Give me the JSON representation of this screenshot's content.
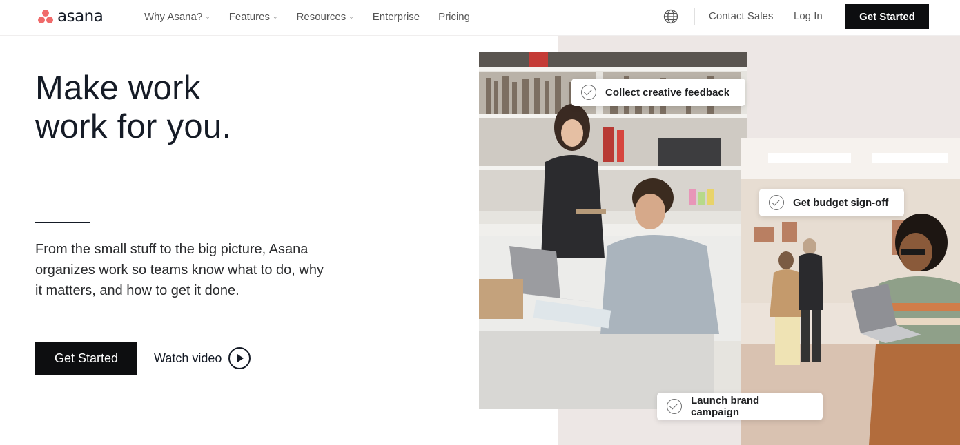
{
  "brand": {
    "name": "asana",
    "color": "#f06a6a"
  },
  "nav": {
    "items": [
      {
        "label": "Why Asana?",
        "dropdown": true
      },
      {
        "label": "Features",
        "dropdown": true
      },
      {
        "label": "Resources",
        "dropdown": true
      },
      {
        "label": "Enterprise",
        "dropdown": false
      },
      {
        "label": "Pricing",
        "dropdown": false
      }
    ],
    "language_icon": "globe-icon",
    "contact_sales": "Contact Sales",
    "log_in": "Log In",
    "get_started": "Get Started"
  },
  "hero": {
    "headline_line1": "Make work",
    "headline_line2": "work for you.",
    "description": "From the small stuff to the big picture, Asana organizes work so teams know what to do, why it matters, and how to get it done.",
    "cta_primary": "Get Started",
    "cta_secondary": "Watch video"
  },
  "collage": {
    "tasks": [
      "Collect creative feedback",
      "Get budget sign-off",
      "Launch brand campaign"
    ]
  },
  "colors": {
    "accent": "#f06a6a",
    "button_bg": "#0d0e10",
    "panel_bg": "#ede7e5"
  }
}
